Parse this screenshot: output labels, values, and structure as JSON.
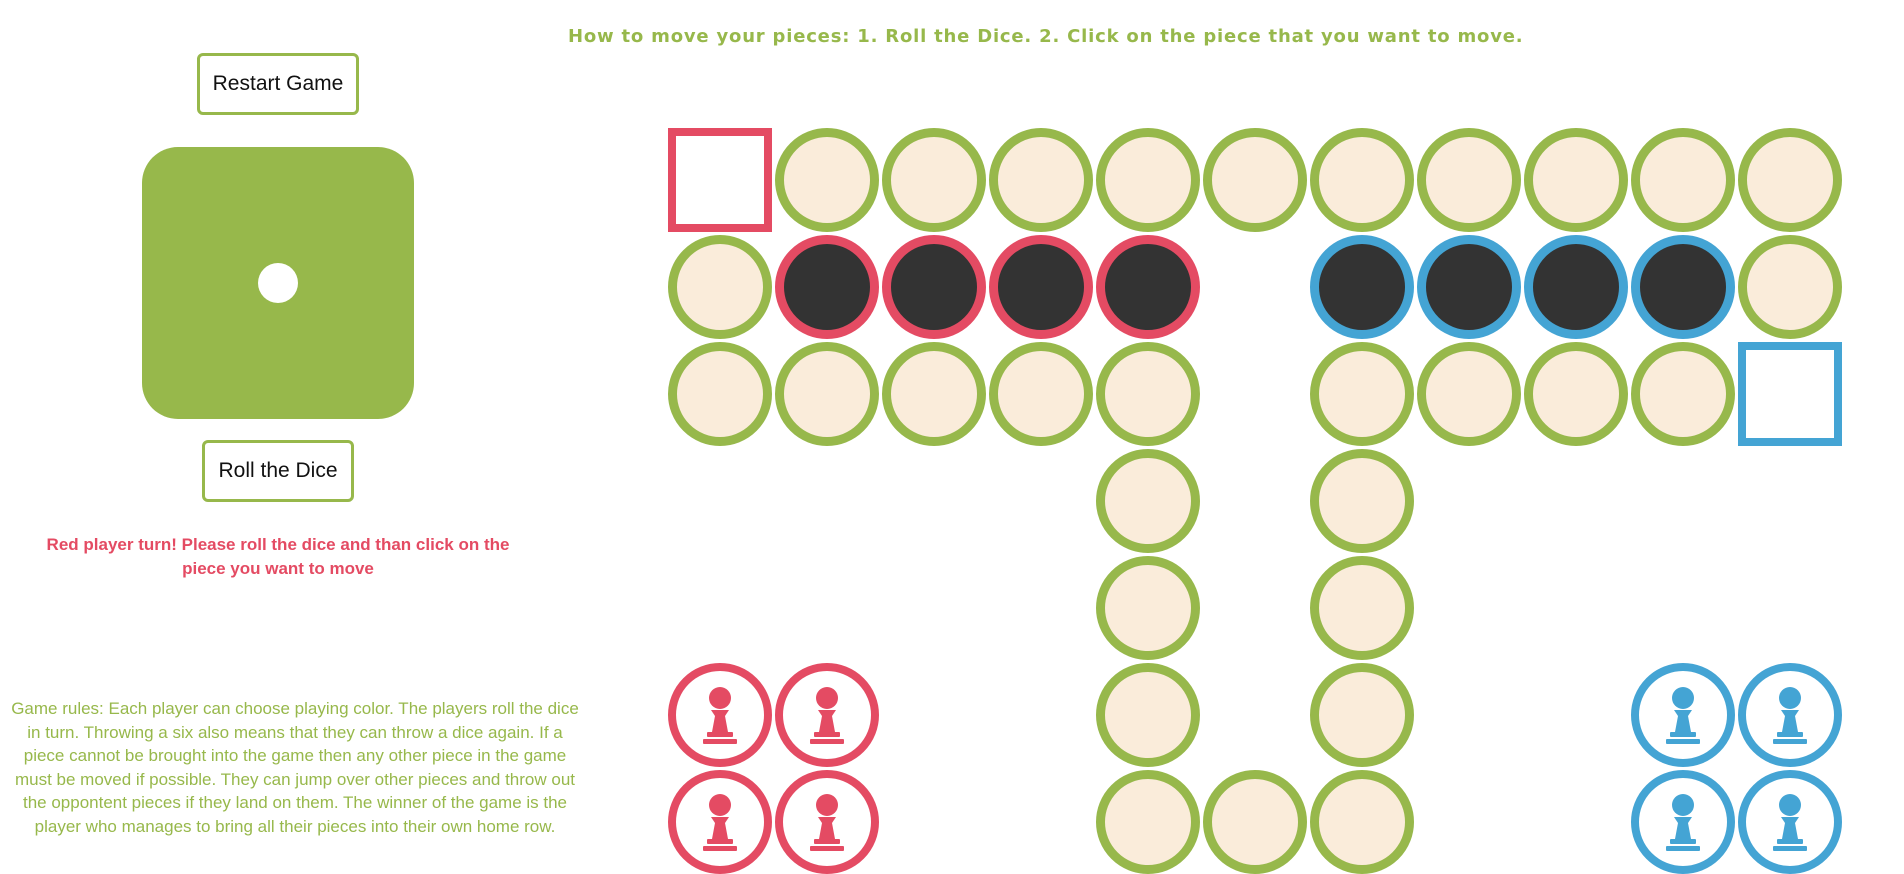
{
  "instructions": "How to move your pieces: 1. Roll the Dice. 2. Click on the piece that you want to move.",
  "buttons": {
    "restart": "Restart Game",
    "roll": "Roll the Dice"
  },
  "dice": {
    "value": 1
  },
  "turn_message": "Red player turn! Please roll the dice and than click on the piece you want to move",
  "rules": "Game rules: Each player can choose playing color. The players roll the dice in turn. Throwing a six also means that they can throw a dice again. If a piece cannot be brought into the game then any other piece in the game must be moved if possible. They can jump over other pieces and throw out the oppontent pieces if they land on them. The winner of the game is the player who manages to bring all their pieces into their own home row.",
  "colors": {
    "green": "#97b84b",
    "red": "#e44b63",
    "blue": "#44a4d4",
    "cream": "#faecda",
    "dark": "#333333"
  },
  "board": {
    "rows": 7,
    "cols": 11,
    "cells": [
      {
        "r": 0,
        "c": 0,
        "type": "start",
        "color": "red"
      },
      {
        "r": 0,
        "c": 1,
        "type": "path"
      },
      {
        "r": 0,
        "c": 2,
        "type": "path"
      },
      {
        "r": 0,
        "c": 3,
        "type": "path"
      },
      {
        "r": 0,
        "c": 4,
        "type": "path"
      },
      {
        "r": 0,
        "c": 5,
        "type": "path"
      },
      {
        "r": 0,
        "c": 6,
        "type": "path"
      },
      {
        "r": 0,
        "c": 7,
        "type": "path"
      },
      {
        "r": 0,
        "c": 8,
        "type": "path"
      },
      {
        "r": 0,
        "c": 9,
        "type": "path"
      },
      {
        "r": 0,
        "c": 10,
        "type": "path"
      },
      {
        "r": 1,
        "c": 0,
        "type": "path"
      },
      {
        "r": 1,
        "c": 1,
        "type": "home",
        "color": "red"
      },
      {
        "r": 1,
        "c": 2,
        "type": "home",
        "color": "red"
      },
      {
        "r": 1,
        "c": 3,
        "type": "home",
        "color": "red"
      },
      {
        "r": 1,
        "c": 4,
        "type": "home",
        "color": "red"
      },
      {
        "r": 1,
        "c": 6,
        "type": "home",
        "color": "blue"
      },
      {
        "r": 1,
        "c": 7,
        "type": "home",
        "color": "blue"
      },
      {
        "r": 1,
        "c": 8,
        "type": "home",
        "color": "blue"
      },
      {
        "r": 1,
        "c": 9,
        "type": "home",
        "color": "blue"
      },
      {
        "r": 1,
        "c": 10,
        "type": "path"
      },
      {
        "r": 2,
        "c": 0,
        "type": "path"
      },
      {
        "r": 2,
        "c": 1,
        "type": "path"
      },
      {
        "r": 2,
        "c": 2,
        "type": "path"
      },
      {
        "r": 2,
        "c": 3,
        "type": "path"
      },
      {
        "r": 2,
        "c": 4,
        "type": "path"
      },
      {
        "r": 2,
        "c": 6,
        "type": "path"
      },
      {
        "r": 2,
        "c": 7,
        "type": "path"
      },
      {
        "r": 2,
        "c": 8,
        "type": "path"
      },
      {
        "r": 2,
        "c": 9,
        "type": "path"
      },
      {
        "r": 2,
        "c": 10,
        "type": "start",
        "color": "blue"
      },
      {
        "r": 3,
        "c": 4,
        "type": "path"
      },
      {
        "r": 3,
        "c": 6,
        "type": "path"
      },
      {
        "r": 4,
        "c": 4,
        "type": "path"
      },
      {
        "r": 4,
        "c": 6,
        "type": "path"
      },
      {
        "r": 5,
        "c": 0,
        "type": "yard",
        "color": "red",
        "piece": true
      },
      {
        "r": 5,
        "c": 1,
        "type": "yard",
        "color": "red",
        "piece": true
      },
      {
        "r": 5,
        "c": 4,
        "type": "path"
      },
      {
        "r": 5,
        "c": 6,
        "type": "path"
      },
      {
        "r": 5,
        "c": 9,
        "type": "yard",
        "color": "blue",
        "piece": true
      },
      {
        "r": 5,
        "c": 10,
        "type": "yard",
        "color": "blue",
        "piece": true
      },
      {
        "r": 6,
        "c": 0,
        "type": "yard",
        "color": "red",
        "piece": true
      },
      {
        "r": 6,
        "c": 1,
        "type": "yard",
        "color": "red",
        "piece": true
      },
      {
        "r": 6,
        "c": 4,
        "type": "path"
      },
      {
        "r": 6,
        "c": 5,
        "type": "path"
      },
      {
        "r": 6,
        "c": 6,
        "type": "path"
      },
      {
        "r": 6,
        "c": 9,
        "type": "yard",
        "color": "blue",
        "piece": true
      },
      {
        "r": 6,
        "c": 10,
        "type": "yard",
        "color": "blue",
        "piece": true
      }
    ]
  }
}
